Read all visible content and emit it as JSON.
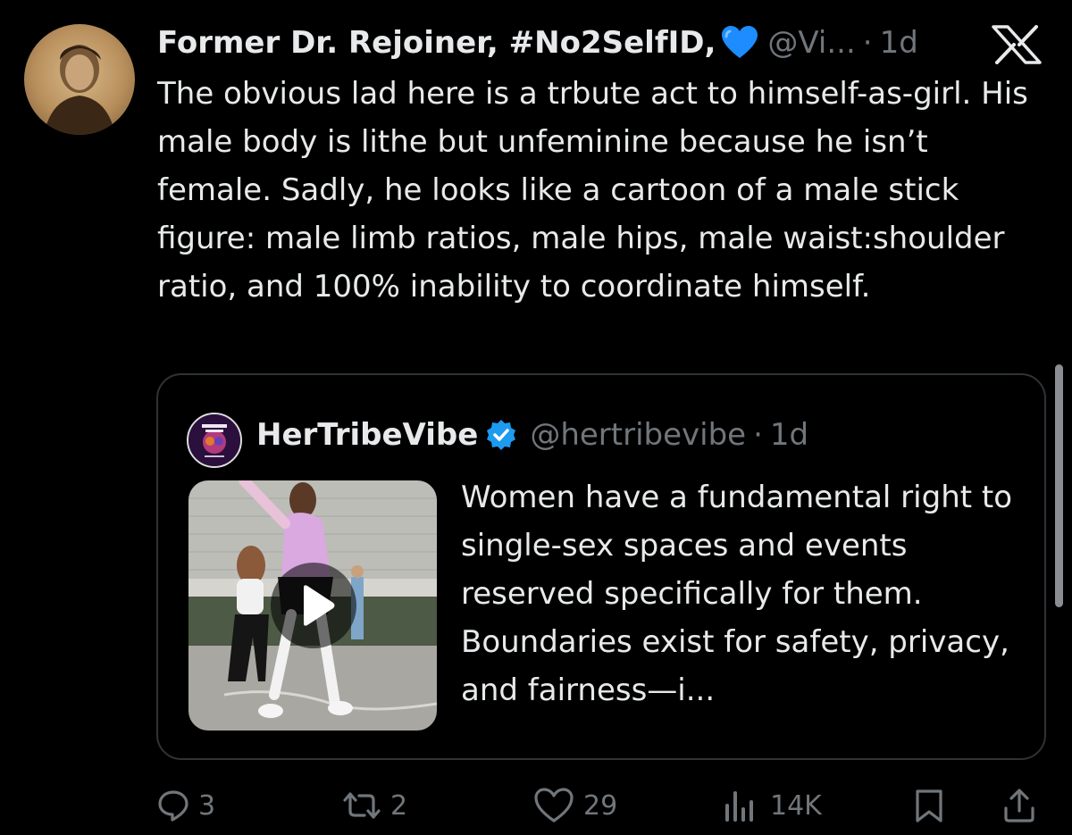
{
  "post": {
    "author_name": "Former Dr. Rejoiner, #No2SelfID,",
    "author_handle": "@Vi...",
    "separator": "·",
    "time": "1d",
    "text": "The obvious lad here is a trbute act to himself-as-girl. His male body is lithe but unfeminine because he isn’t female. Sadly, he looks like a cartoon of a male stick figure: male limb ratios, male hips, male waist:shoulder ratio, and 100% inability to coordinate himself."
  },
  "quoted_post": {
    "author_name": "HerTribeVibe",
    "author_handle": "@hertribevibe",
    "separator": "·",
    "time": "1d",
    "text": "Women have a fundamental right to single-sex spaces and events reserved specifically for them. Boundaries exist for safety, privacy, and fairness—i...",
    "avatar_lettering": "HER TRIBE VIBE",
    "media_icon": "play-icon"
  },
  "actions": {
    "replies": "3",
    "reposts": "2",
    "likes": "29",
    "views": "14K"
  },
  "icons": {
    "brand": "x-logo-icon",
    "name_emoji": "blue-heart-icon",
    "verified": "verified-badge-icon",
    "reply": "reply-icon",
    "repost": "repost-icon",
    "like": "heart-icon",
    "views": "views-icon",
    "bookmark": "bookmark-icon",
    "share": "share-icon"
  },
  "colors": {
    "background": "#000000",
    "text": "#e7e9ea",
    "secondary_text": "#71767b",
    "border": "#2f3336",
    "verified_blue": "#1d9bf0",
    "heart_blue": "#1c8cff"
  }
}
